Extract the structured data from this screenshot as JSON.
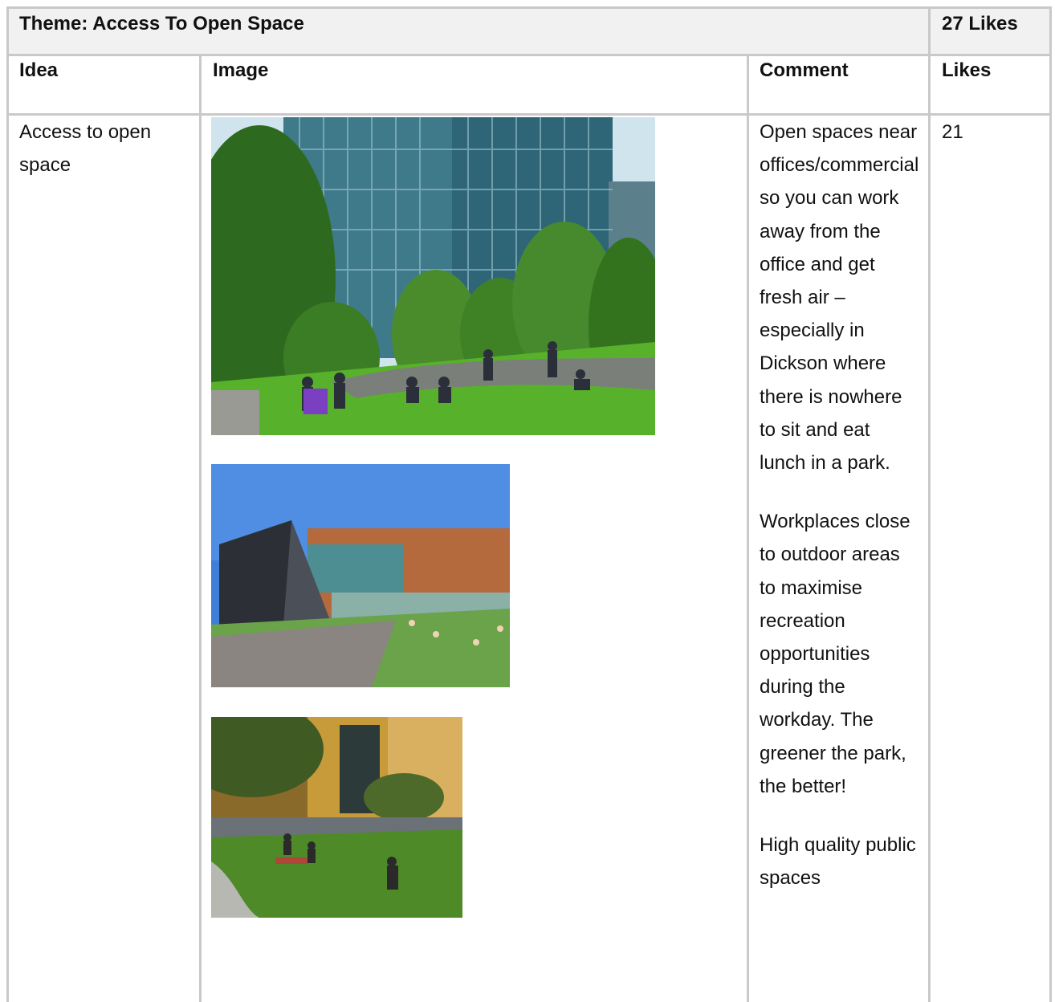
{
  "table": {
    "theme_title": "Theme: Access To Open Space",
    "theme_likes": "27 Likes",
    "headers": {
      "idea": "Idea",
      "image": "Image",
      "comment": "Comment",
      "likes": "Likes"
    },
    "rows": [
      {
        "idea": "Access to open space",
        "likes": "21",
        "images": [
          "park-with-office-towers-image",
          "modern-building-lawn-image",
          "urban-park-sunset-image"
        ],
        "comments": [
          "Open spaces near offices/commercial so you can work away from the office and get fresh air – especially in Dickson where there is nowhere to sit and eat lunch in a park.",
          "Workplaces close to outdoor areas to maximise recreation opportunities during the workday. The greener the park, the better!",
          "High quality public spaces"
        ]
      }
    ]
  }
}
